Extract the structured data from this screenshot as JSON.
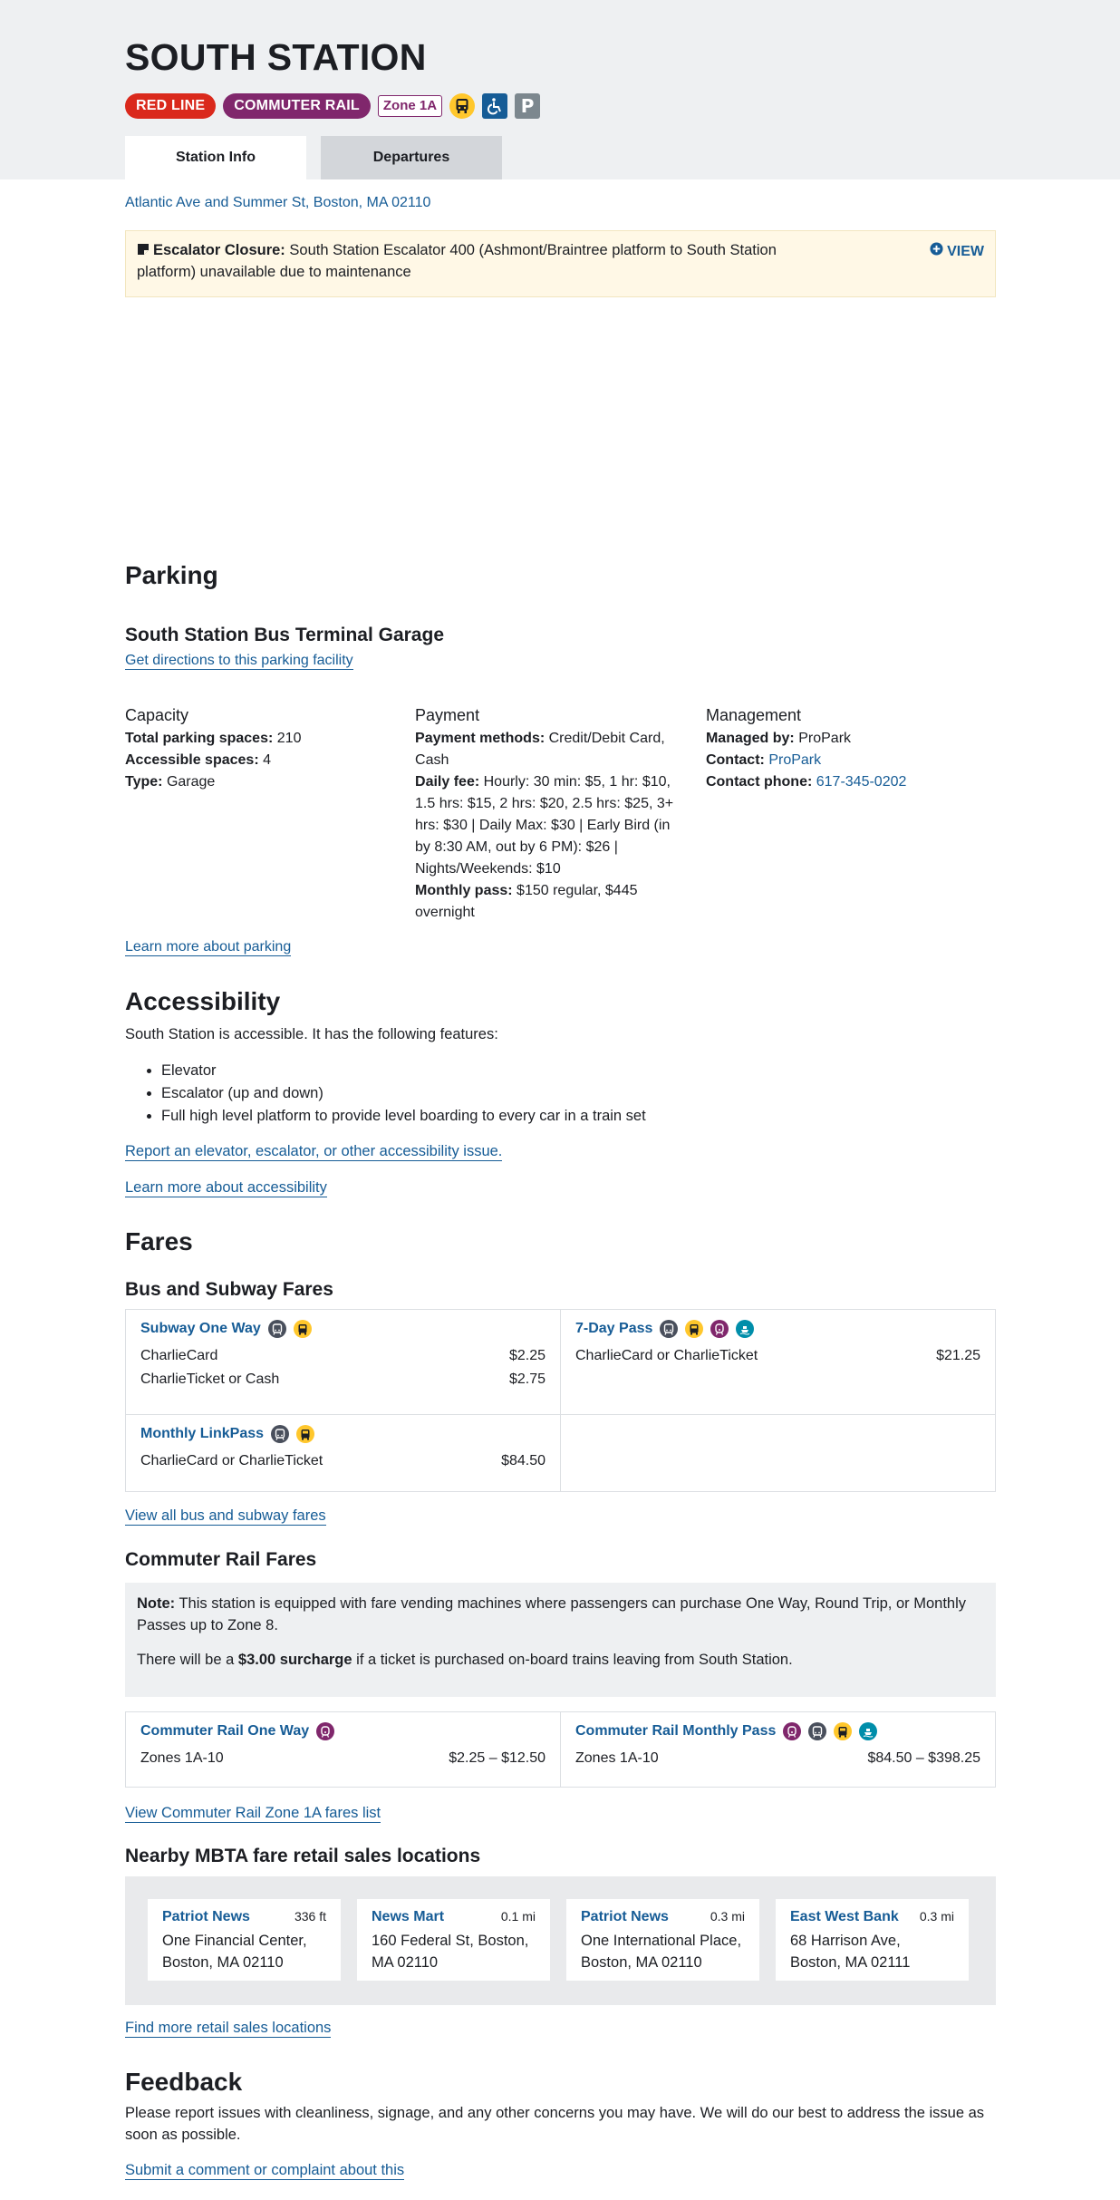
{
  "station": {
    "name": "SOUTH STATION",
    "badges": {
      "red_line": "RED LINE",
      "commuter_rail": "COMMUTER RAIL",
      "zone": "Zone 1A"
    },
    "icons": [
      "bus-icon",
      "accessible-icon",
      "parking-icon"
    ],
    "address": "Atlantic Ave and Summer St, Boston, MA 02110"
  },
  "colors": {
    "red_line": "#da291c",
    "commuter_rail": "#80276c",
    "bus": "#ffc72c",
    "link": "#165c96",
    "subway": "#494f5c",
    "ferry": "#008eaa"
  },
  "tabs": [
    {
      "label": "Station Info",
      "active": true
    },
    {
      "label": "Departures",
      "active": false
    }
  ],
  "alert": {
    "title": "Escalator Closure:",
    "text": "South Station Escalator 400 (Ashmont/Braintree platform to South Station platform) unavailable due to maintenance",
    "action": "VIEW"
  },
  "parking": {
    "heading": "Parking",
    "facility": "South Station Bus Terminal Garage",
    "directions_link": "Get directions to this parking facility",
    "capacity": {
      "heading": "Capacity",
      "total_label": "Total parking spaces:",
      "total_value": "210",
      "accessible_label": "Accessible spaces:",
      "accessible_value": "4",
      "type_label": "Type:",
      "type_value": "Garage"
    },
    "payment": {
      "heading": "Payment",
      "methods_label": "Payment methods:",
      "methods_value": "Credit/Debit Card, Cash",
      "daily_label": "Daily fee:",
      "daily_value": "Hourly: 30 min: $5, 1 hr: $10, 1.5 hrs: $15, 2 hrs: $20, 2.5 hrs: $25, 3+ hrs: $30 | Daily Max: $30 | Early Bird (in by 8:30 AM, out by 6 PM): $26 | Nights/Weekends: $10",
      "monthly_label": "Monthly pass:",
      "monthly_value": "$150 regular, $445 overnight"
    },
    "management": {
      "heading": "Management",
      "managed_label": "Managed by:",
      "managed_value": "ProPark",
      "contact_label": "Contact:",
      "contact_value": "ProPark",
      "phone_label": "Contact phone:",
      "phone_value": "617-345-0202"
    },
    "learn_more": "Learn more about parking"
  },
  "accessibility": {
    "heading": "Accessibility",
    "intro": "South Station is accessible. It has the following features:",
    "features": [
      "Elevator",
      "Escalator (up and down)",
      "Full high level platform to provide level boarding to every car in a train set"
    ],
    "report_link": "Report an elevator, escalator, or other accessibility issue.",
    "learn_more": "Learn more about accessibility"
  },
  "fares": {
    "heading": "Fares",
    "bus_subway": {
      "heading": "Bus and Subway Fares",
      "subway_one_way": {
        "title": "Subway One Way",
        "rows": [
          {
            "label": "CharlieCard",
            "price": "$2.25"
          },
          {
            "label": "CharlieTicket or Cash",
            "price": "$2.75"
          }
        ]
      },
      "seven_day": {
        "title": "7-Day Pass",
        "rows": [
          {
            "label": "CharlieCard or CharlieTicket",
            "price": "$21.25"
          }
        ]
      },
      "monthly": {
        "title": "Monthly LinkPass",
        "rows": [
          {
            "label": "CharlieCard or CharlieTicket",
            "price": "$84.50"
          }
        ]
      },
      "view_all": "View all bus and subway fares"
    },
    "commuter_rail": {
      "heading": "Commuter Rail Fares",
      "note_label": "Note:",
      "note_text": "This station is equipped with fare vending machines where passengers can purchase One Way, Round Trip, or Monthly Passes up to Zone 8.",
      "surcharge_pre": "There will be a",
      "surcharge_bold": "$3.00 surcharge",
      "surcharge_post": "if a ticket is purchased on-board trains leaving from South Station.",
      "one_way": {
        "title": "Commuter Rail One Way",
        "zones": "Zones 1A-10",
        "price": "$2.25 – $12.50"
      },
      "monthly": {
        "title": "Commuter Rail Monthly Pass",
        "zones": "Zones 1A-10",
        "price": "$84.50 – $398.25"
      },
      "view_list": "View Commuter Rail Zone 1A fares list"
    },
    "retail": {
      "heading": "Nearby MBTA fare retail sales locations",
      "locations": [
        {
          "name": "Patriot News",
          "distance": "336 ft",
          "address": "One Financial Center, Boston, MA 02110"
        },
        {
          "name": "News Mart",
          "distance": "0.1 mi",
          "address": "160 Federal St, Boston, MA 02110"
        },
        {
          "name": "Patriot News",
          "distance": "0.3 mi",
          "address": "One International Place, Boston, MA 02110"
        },
        {
          "name": "East West Bank",
          "distance": "0.3 mi",
          "address": "68 Harrison Ave, Boston, MA 02111"
        }
      ],
      "find_more": "Find more retail sales locations"
    }
  },
  "feedback": {
    "heading": "Feedback",
    "text": "Please report issues with cleanliness, signage, and any other concerns you may have. We will do our best to address the issue as soon as possible.",
    "link": "Submit a comment or complaint about this"
  }
}
